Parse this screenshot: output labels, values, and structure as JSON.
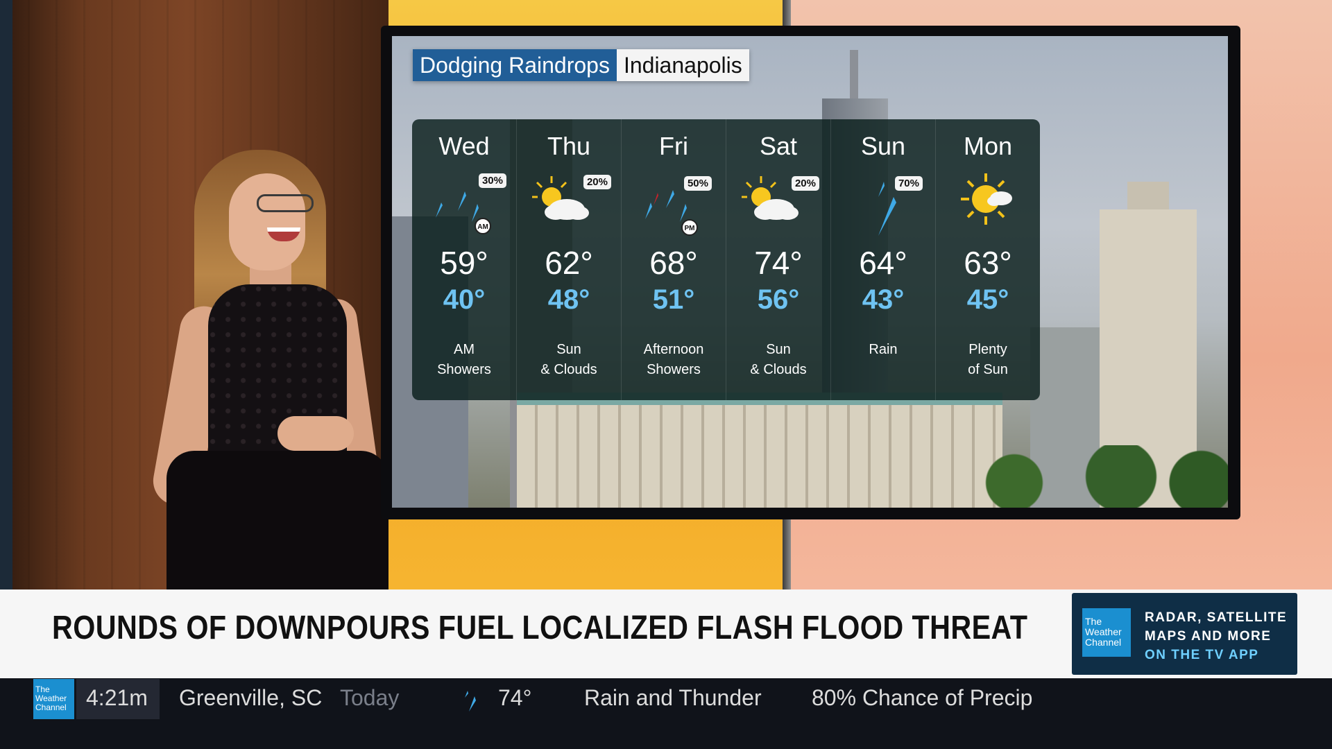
{
  "screen": {
    "title": "Dodging Raindrops",
    "city": "Indianapolis",
    "days": [
      {
        "name": "Wed",
        "pct": "30%",
        "hi": "59°",
        "lo": "40°",
        "cond1": "AM",
        "cond2": "Showers",
        "icon": "rain-am-icon",
        "tag": "AM"
      },
      {
        "name": "Thu",
        "pct": "20%",
        "hi": "62°",
        "lo": "48°",
        "cond1": "Sun",
        "cond2": "& Clouds",
        "icon": "partly-sunny-icon"
      },
      {
        "name": "Fri",
        "pct": "50%",
        "hi": "68°",
        "lo": "51°",
        "cond1": "Afternoon",
        "cond2": "Showers",
        "icon": "rain-pm-icon",
        "tag": "PM"
      },
      {
        "name": "Sat",
        "pct": "20%",
        "hi": "74°",
        "lo": "56°",
        "cond1": "Sun",
        "cond2": "& Clouds",
        "icon": "partly-sunny-icon"
      },
      {
        "name": "Sun",
        "pct": "70%",
        "hi": "64°",
        "lo": "43°",
        "cond1": "Rain",
        "cond2": "",
        "icon": "rain-icon"
      },
      {
        "name": "Mon",
        "pct": "",
        "hi": "63°",
        "lo": "45°",
        "cond1": "Plenty",
        "cond2": "of Sun",
        "icon": "sunny-icon"
      }
    ]
  },
  "lower_third": {
    "headline": "ROUNDS OF DOWNPOURS FUEL LOCALIZED FLASH FLOOD THREAT",
    "promo_logo": "The Weather Channel",
    "promo_line1": "RADAR, SATELLITE",
    "promo_line2": "MAPS AND MORE",
    "promo_line3": "ON THE TV APP"
  },
  "ticker": {
    "logo": "The Weather Channel",
    "time": "4:21m",
    "location": "Greenville, SC",
    "period": "Today",
    "temp": "74°",
    "condition": "Rain and Thunder",
    "precip": "80% Chance of Precip"
  },
  "colors": {
    "brand_blue": "#215e97",
    "low_temp": "#6fc3f2",
    "twc_logo": "#1b8fd0"
  }
}
